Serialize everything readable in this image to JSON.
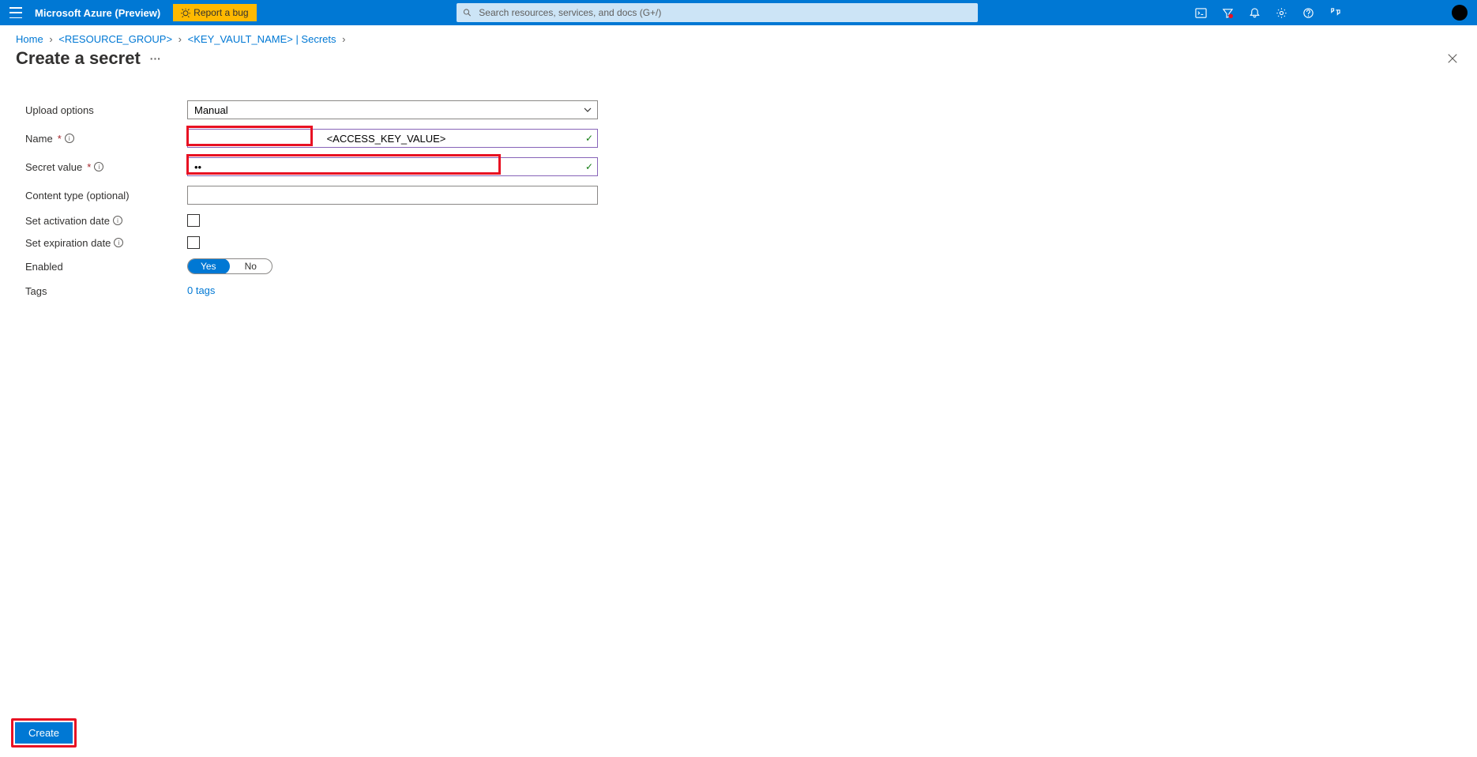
{
  "header": {
    "brand": "Microsoft Azure (Preview)",
    "bug_label": "Report a bug",
    "search_placeholder": "Search resources, services, and docs (G+/)"
  },
  "breadcrumb": {
    "home": "Home",
    "resource_group": "<RESOURCE_GROUP>",
    "secrets": "<KEY_VAULT_NAME> | Secrets"
  },
  "page": {
    "title": "Create a secret"
  },
  "form": {
    "upload_options_label": "Upload options",
    "upload_options_value": "Manual",
    "name_label": "Name",
    "name_value": "<ACCESS_KEY_VALUE>",
    "secret_value_label": "Secret value",
    "secret_value_value": "••",
    "content_type_label": "Content type (optional)",
    "content_type_value": "",
    "activation_label": "Set activation date",
    "expiration_label": "Set expiration date",
    "enabled_label": "Enabled",
    "enabled_yes": "Yes",
    "enabled_no": "No",
    "tags_label": "Tags",
    "tags_value": "0 tags"
  },
  "footer": {
    "create_label": "Create"
  }
}
